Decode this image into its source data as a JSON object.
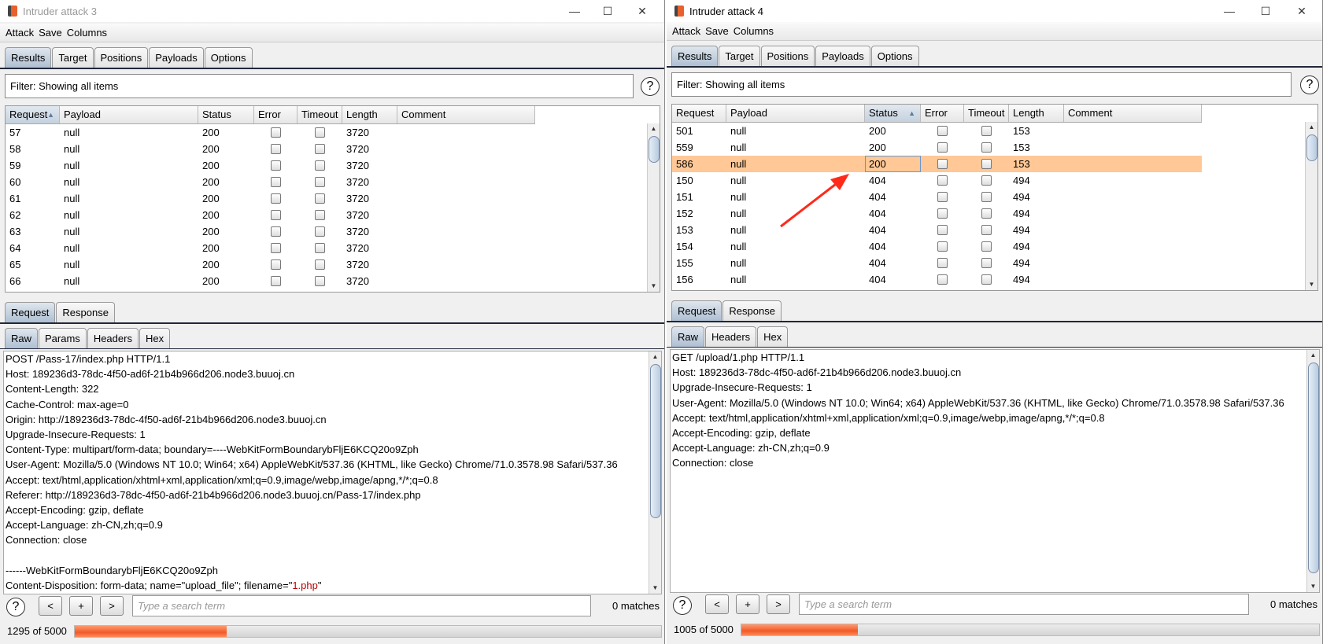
{
  "windows": [
    {
      "title": "Intruder attack 3",
      "active": false,
      "controls": {
        "minimize": "—",
        "maximize": "☐",
        "close": "✕"
      },
      "menu": [
        "Attack",
        "Save",
        "Columns"
      ],
      "tabs": [
        "Results",
        "Target",
        "Positions",
        "Payloads",
        "Options"
      ],
      "active_tab": "Results",
      "filter": "Filter: Showing all items",
      "help": "?",
      "columns": [
        "Request",
        "Payload",
        "Status",
        "Error",
        "Timeout",
        "Length",
        "Comment"
      ],
      "sorted_column": "Request",
      "sort_direction": "ascending",
      "rows": [
        {
          "request": "57",
          "payload": "null",
          "status": "200",
          "error": false,
          "timeout": false,
          "length": "3720",
          "comment": ""
        },
        {
          "request": "58",
          "payload": "null",
          "status": "200",
          "error": false,
          "timeout": false,
          "length": "3720",
          "comment": ""
        },
        {
          "request": "59",
          "payload": "null",
          "status": "200",
          "error": false,
          "timeout": false,
          "length": "3720",
          "comment": ""
        },
        {
          "request": "60",
          "payload": "null",
          "status": "200",
          "error": false,
          "timeout": false,
          "length": "3720",
          "comment": ""
        },
        {
          "request": "61",
          "payload": "null",
          "status": "200",
          "error": false,
          "timeout": false,
          "length": "3720",
          "comment": ""
        },
        {
          "request": "62",
          "payload": "null",
          "status": "200",
          "error": false,
          "timeout": false,
          "length": "3720",
          "comment": ""
        },
        {
          "request": "63",
          "payload": "null",
          "status": "200",
          "error": false,
          "timeout": false,
          "length": "3720",
          "comment": ""
        },
        {
          "request": "64",
          "payload": "null",
          "status": "200",
          "error": false,
          "timeout": false,
          "length": "3720",
          "comment": ""
        },
        {
          "request": "65",
          "payload": "null",
          "status": "200",
          "error": false,
          "timeout": false,
          "length": "3720",
          "comment": ""
        },
        {
          "request": "66",
          "payload": "null",
          "status": "200",
          "error": false,
          "timeout": false,
          "length": "3720",
          "comment": ""
        }
      ],
      "msg_tabs": [
        "Request",
        "Response"
      ],
      "active_msg_tab": "Request",
      "view_tabs": [
        "Raw",
        "Params",
        "Headers",
        "Hex"
      ],
      "active_view_tab": "Raw",
      "raw_lines": [
        "POST /Pass-17/index.php HTTP/1.1",
        "Host: 189236d3-78dc-4f50-ad6f-21b4b966d206.node3.buuoj.cn",
        "Content-Length: 322",
        "Cache-Control: max-age=0",
        "Origin: http://189236d3-78dc-4f50-ad6f-21b4b966d206.node3.buuoj.cn",
        "Upgrade-Insecure-Requests: 1",
        "Content-Type: multipart/form-data; boundary=----WebKitFormBoundarybFljE6KCQ20o9Zph",
        "User-Agent: Mozilla/5.0 (Windows NT 10.0; Win64; x64) AppleWebKit/537.36 (KHTML, like Gecko) Chrome/71.0.3578.98 Safari/537.36",
        "Accept: text/html,application/xhtml+xml,application/xml;q=0.9,image/webp,image/apng,*/*;q=0.8",
        "Referer: http://189236d3-78dc-4f50-ad6f-21b4b966d206.node3.buuoj.cn/Pass-17/index.php",
        "Accept-Encoding: gzip, deflate",
        "Accept-Language: zh-CN,zh;q=0.9",
        "Connection: close",
        "",
        "------WebKitFormBoundarybFljE6KCQ20o9Zph",
        "Content-Disposition: form-data; name=\"upload_file\"; filename=\""
      ],
      "raw_last_highlight": "1.php",
      "raw_last_tail": "\"",
      "search": {
        "prev": "<",
        "add": "+",
        "next": ">",
        "placeholder": "Type a search term",
        "matches": "0 matches"
      },
      "progress_text": "1295 of 5000",
      "progress_fraction": 0.259
    },
    {
      "title": "Intruder attack 4",
      "active": true,
      "controls": {
        "minimize": "—",
        "maximize": "☐",
        "close": "✕"
      },
      "menu": [
        "Attack",
        "Save",
        "Columns"
      ],
      "tabs": [
        "Results",
        "Target",
        "Positions",
        "Payloads",
        "Options"
      ],
      "active_tab": "Results",
      "filter": "Filter: Showing all items",
      "help": "?",
      "columns": [
        "Request",
        "Payload",
        "Status",
        "Error",
        "Timeout",
        "Length",
        "Comment"
      ],
      "sorted_column": "Status",
      "sort_direction": "ascending",
      "selected_row": "586",
      "rows": [
        {
          "request": "501",
          "payload": "null",
          "status": "200",
          "error": false,
          "timeout": false,
          "length": "153",
          "comment": ""
        },
        {
          "request": "559",
          "payload": "null",
          "status": "200",
          "error": false,
          "timeout": false,
          "length": "153",
          "comment": ""
        },
        {
          "request": "586",
          "payload": "null",
          "status": "200",
          "error": false,
          "timeout": false,
          "length": "153",
          "comment": ""
        },
        {
          "request": "150",
          "payload": "null",
          "status": "404",
          "error": false,
          "timeout": false,
          "length": "494",
          "comment": ""
        },
        {
          "request": "151",
          "payload": "null",
          "status": "404",
          "error": false,
          "timeout": false,
          "length": "494",
          "comment": ""
        },
        {
          "request": "152",
          "payload": "null",
          "status": "404",
          "error": false,
          "timeout": false,
          "length": "494",
          "comment": ""
        },
        {
          "request": "153",
          "payload": "null",
          "status": "404",
          "error": false,
          "timeout": false,
          "length": "494",
          "comment": ""
        },
        {
          "request": "154",
          "payload": "null",
          "status": "404",
          "error": false,
          "timeout": false,
          "length": "494",
          "comment": ""
        },
        {
          "request": "155",
          "payload": "null",
          "status": "404",
          "error": false,
          "timeout": false,
          "length": "494",
          "comment": ""
        },
        {
          "request": "156",
          "payload": "null",
          "status": "404",
          "error": false,
          "timeout": false,
          "length": "494",
          "comment": ""
        }
      ],
      "msg_tabs": [
        "Request",
        "Response"
      ],
      "active_msg_tab": "Request",
      "view_tabs": [
        "Raw",
        "Headers",
        "Hex"
      ],
      "active_view_tab": "Raw",
      "raw_lines": [
        "GET /upload/1.php HTTP/1.1",
        "Host: 189236d3-78dc-4f50-ad6f-21b4b966d206.node3.buuoj.cn",
        "Upgrade-Insecure-Requests: 1",
        "User-Agent: Mozilla/5.0 (Windows NT 10.0; Win64; x64) AppleWebKit/537.36 (KHTML, like Gecko) Chrome/71.0.3578.98 Safari/537.36",
        "Accept: text/html,application/xhtml+xml,application/xml;q=0.9,image/webp,image/apng,*/*;q=0.8",
        "Accept-Encoding: gzip, deflate",
        "Accept-Language: zh-CN,zh;q=0.9",
        "Connection: close"
      ],
      "search": {
        "prev": "<",
        "add": "+",
        "next": ">",
        "placeholder": "Type a search term",
        "matches": "0 matches"
      },
      "progress_text": "1005 of 5000",
      "progress_fraction": 0.201
    }
  ],
  "colors": {
    "selected_row": "#ffc896",
    "progress": "#f05a28",
    "annotation_arrow": "#ff2a1a",
    "highlight_text": "#b00000"
  }
}
